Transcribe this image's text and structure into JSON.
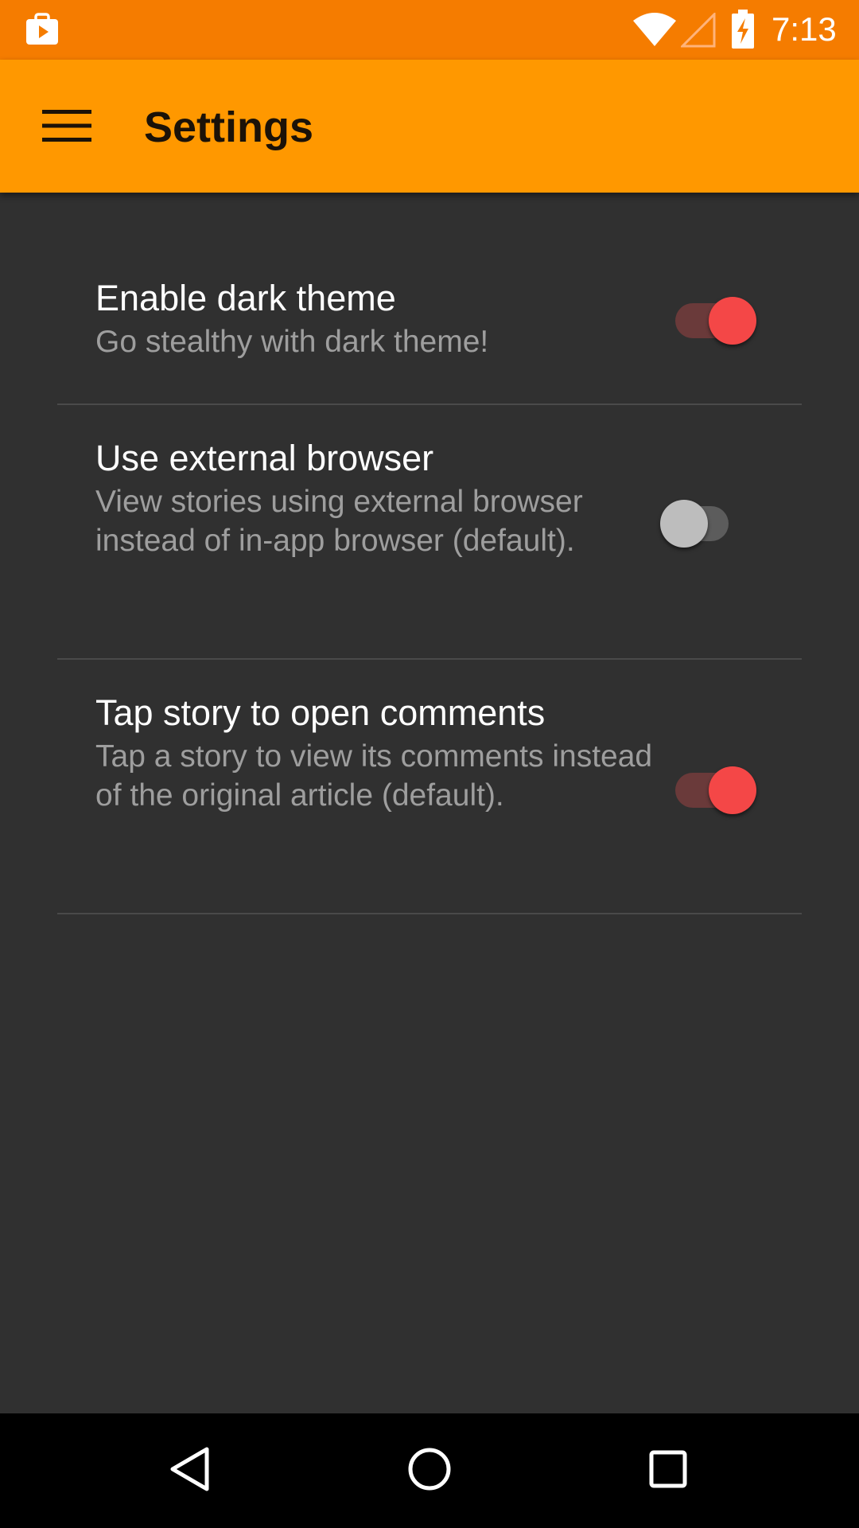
{
  "status_bar": {
    "time": "7:13",
    "icons": [
      "play-store-icon",
      "wifi-icon",
      "cellular-signal-icon",
      "battery-charging-icon"
    ],
    "background": "#F57C00"
  },
  "app_bar": {
    "title": "Settings",
    "menu_icon": "hamburger-menu-icon",
    "background": "#FF9800"
  },
  "settings": [
    {
      "title": "Enable dark theme",
      "summary": "Go stealthy with dark theme!",
      "enabled": true
    },
    {
      "title": "Use external browser",
      "summary": "View stories using external browser instead of in-app browser (default).",
      "enabled": false
    },
    {
      "title": "Tap story to open comments",
      "summary": "Tap a story to view its comments instead of the original article (default).",
      "enabled": true
    }
  ],
  "nav_bar": {
    "icons": [
      "back-icon",
      "home-icon",
      "recents-icon"
    ]
  },
  "colors": {
    "background": "#303030",
    "accent": "#F44747",
    "title_text": "#FFFFFF",
    "summary_text": "#9E9E9E",
    "divider": "#4A4A4A"
  }
}
